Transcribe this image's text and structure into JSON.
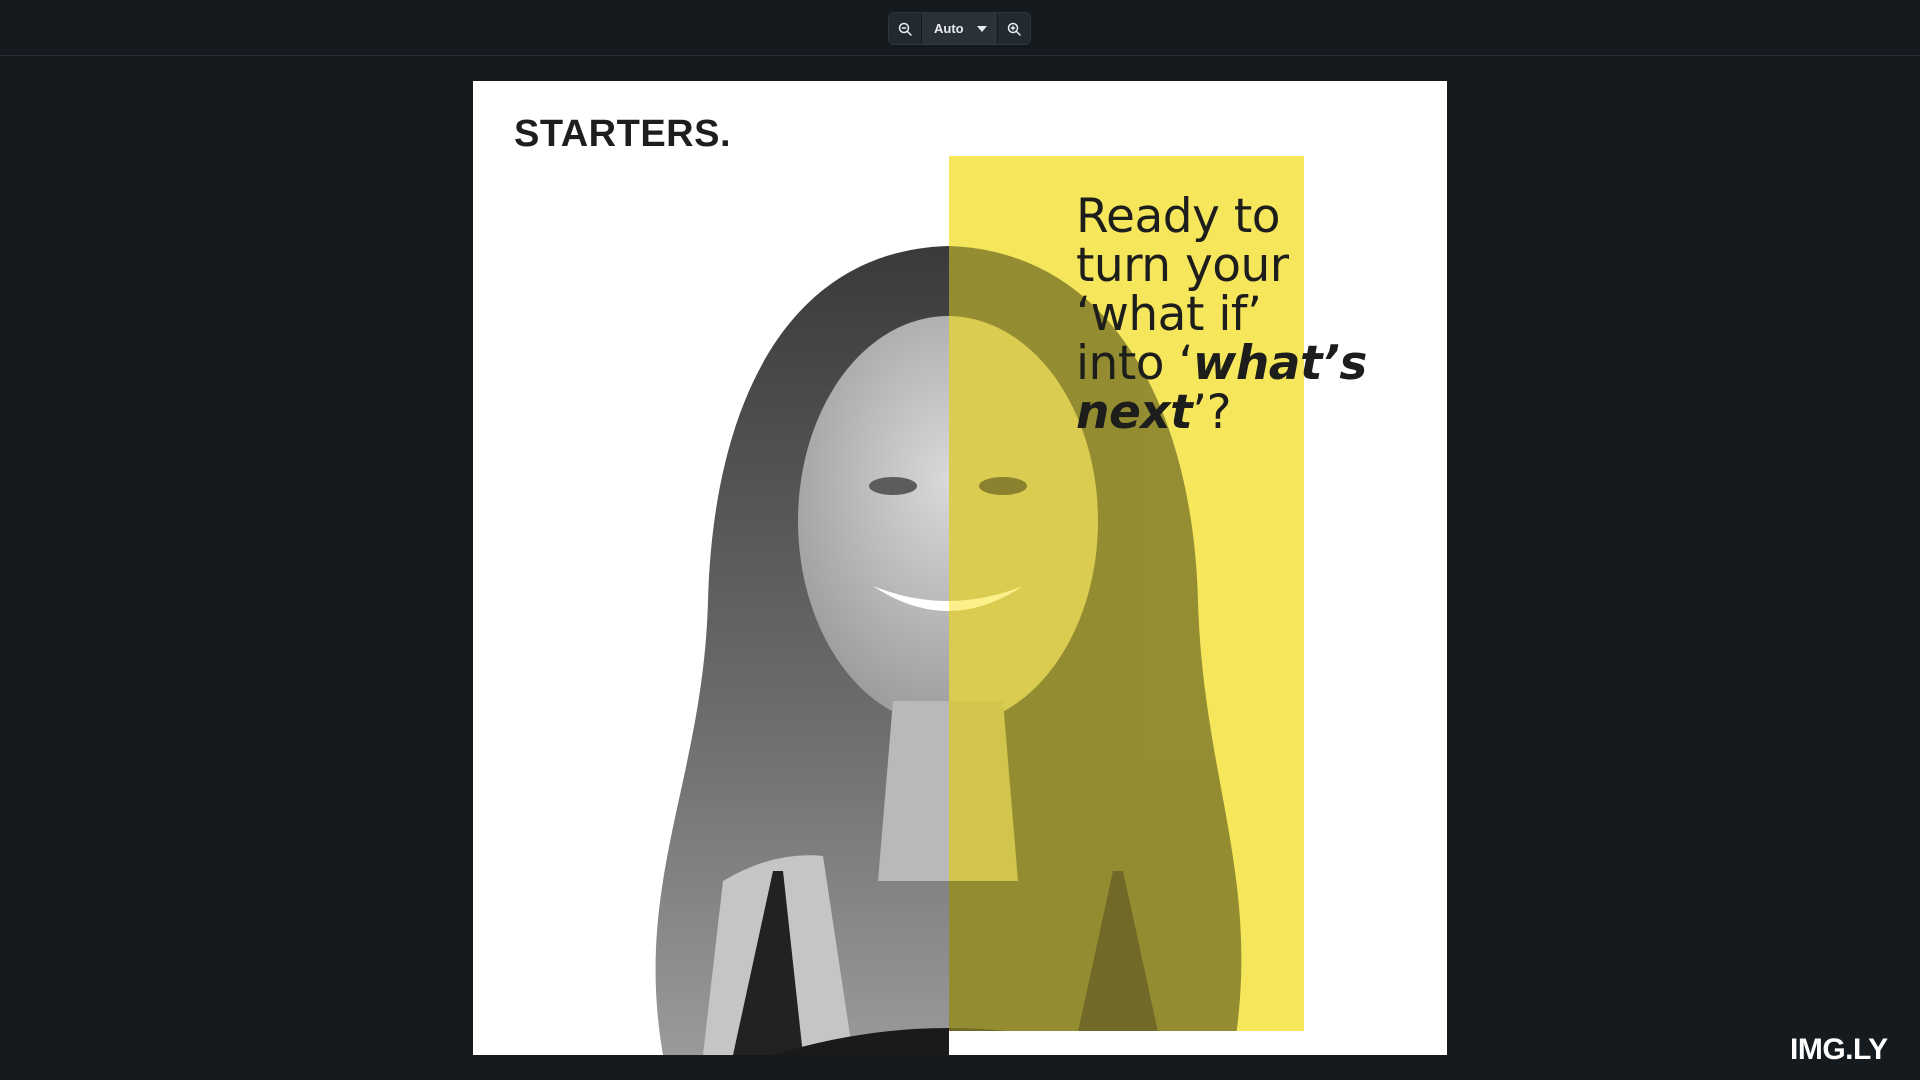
{
  "toolbar": {
    "zoom_out_icon": "zoom-out-icon",
    "zoom_in_icon": "zoom-in-icon",
    "zoom_level": "Auto"
  },
  "design": {
    "brand": "STARTERS.",
    "headline": {
      "line1": "Ready to",
      "line2": "turn your",
      "line3": "‘what if’",
      "line4_pre": "into ‘",
      "line4_bold": "what’s",
      "line5_bold": "next",
      "line5_post": "’?"
    },
    "accent_color": "#f5e65c"
  },
  "footer": {
    "logo": "IMG.LY"
  }
}
